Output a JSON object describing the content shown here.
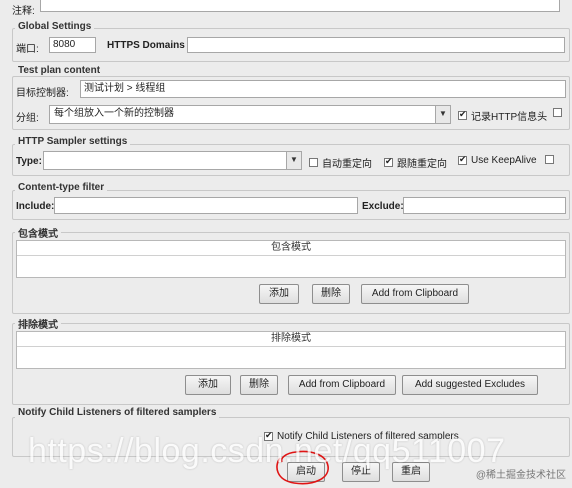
{
  "top_label": "注释:",
  "global": {
    "title": "Global Settings",
    "port_label": "端口:",
    "port_value": "8080",
    "https_label": "HTTPS Domains :"
  },
  "test_plan": {
    "title": "Test plan content",
    "target_label": "目标控制器:",
    "target_value": "测试计划 > 线程组",
    "group_label": "分组:",
    "group_value": "每个组放入一个新的控制器",
    "record_label": "记录HTTP信息头"
  },
  "sampler": {
    "title": "HTTP Sampler settings",
    "type_label": "Type:",
    "auto_redirect": "自动重定向",
    "follow_redirect": "跟随重定向",
    "keepalive": "Use KeepAlive"
  },
  "content_filter": {
    "title": "Content-type filter",
    "include_label": "Include:",
    "exclude_label": "Exclude:"
  },
  "include_patterns": {
    "title": "包含模式",
    "column": "包含模式",
    "add": "添加",
    "delete": "删除",
    "clipboard": "Add from Clipboard"
  },
  "exclude_patterns": {
    "title": "排除模式",
    "column": "排除模式",
    "add": "添加",
    "delete": "删除",
    "clipboard": "Add from Clipboard",
    "suggested": "Add suggested Excludes"
  },
  "notify": {
    "title": "Notify Child Listeners of filtered samplers",
    "checkbox_label": "Notify Child Listeners of filtered samplers"
  },
  "bottom": {
    "start": "启动",
    "stop": "停止",
    "restart": "重启"
  },
  "watermark": "https://blog.csdn.net/qq511007",
  "corner_watermark": "@稀土掘金技术社区",
  "colors": {
    "annotation_red": "#e01414"
  }
}
